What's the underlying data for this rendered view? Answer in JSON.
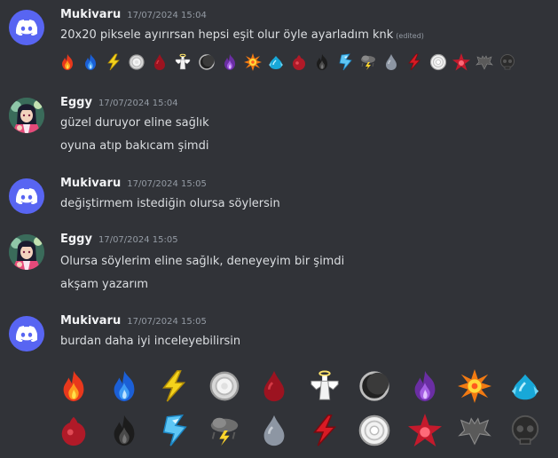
{
  "messages": [
    {
      "author": "Mukivaru",
      "timestamp": "17/07/2024 15:04",
      "avatar": "discord-logo",
      "lines": [
        "20x20 piksele ayırırsan hepsi eşit olur öyle ayarladım knk"
      ],
      "edited_label": "(edited)"
    },
    {
      "author": "Eggy",
      "timestamp": "17/07/2024 15:04",
      "avatar": "anime-character",
      "lines": [
        "güzel duruyor eline sağlık",
        "oyuna atıp bakıcam şimdi"
      ]
    },
    {
      "author": "Mukivaru",
      "timestamp": "17/07/2024 15:05",
      "avatar": "discord-logo",
      "lines": [
        "değiştirmem istediğin olursa söylersin"
      ]
    },
    {
      "author": "Eggy",
      "timestamp": "17/07/2024 15:05",
      "avatar": "anime-character",
      "lines": [
        "Olursa söylerim eline sağlık, deneyeyim bir şimdi",
        "akşam yazarım"
      ]
    },
    {
      "author": "Mukivaru",
      "timestamp": "17/07/2024 15:05",
      "avatar": "discord-logo",
      "lines": [
        "burdan daha iyi inceleyebilirsin"
      ]
    }
  ],
  "emoji_strip": [
    "fire-icon",
    "blue-fire-icon",
    "lightning-icon",
    "disc-icon",
    "blood-drop-icon",
    "angel-icon",
    "moon-icon",
    "purple-fire-icon",
    "explosion-icon",
    "water-icon",
    "red-drop-icon",
    "dark-fire-icon",
    "ice-icon",
    "storm-cloud-icon",
    "grey-drop-icon",
    "red-lightning-icon",
    "white-disc-icon",
    "red-star-icon",
    "bat-icon",
    "dark-skull-icon"
  ],
  "emoji_grid_rows": [
    [
      "fire-icon",
      "blue-fire-icon",
      "lightning-icon",
      "disc-icon",
      "blood-drop-icon",
      "angel-icon",
      "moon-icon",
      "purple-fire-icon",
      "explosion-icon",
      "water-icon"
    ],
    [
      "red-drop-icon",
      "dark-fire-icon",
      "ice-icon",
      "storm-cloud-icon",
      "grey-drop-icon",
      "red-lightning-icon",
      "white-disc-icon",
      "red-star-icon",
      "bat-icon",
      "dark-skull-icon"
    ]
  ],
  "colors": {
    "background": "#313338",
    "author": "#f2f3f5",
    "text": "#dbdee1",
    "muted": "#949ba4",
    "discord_blurple": "#5865f2"
  }
}
